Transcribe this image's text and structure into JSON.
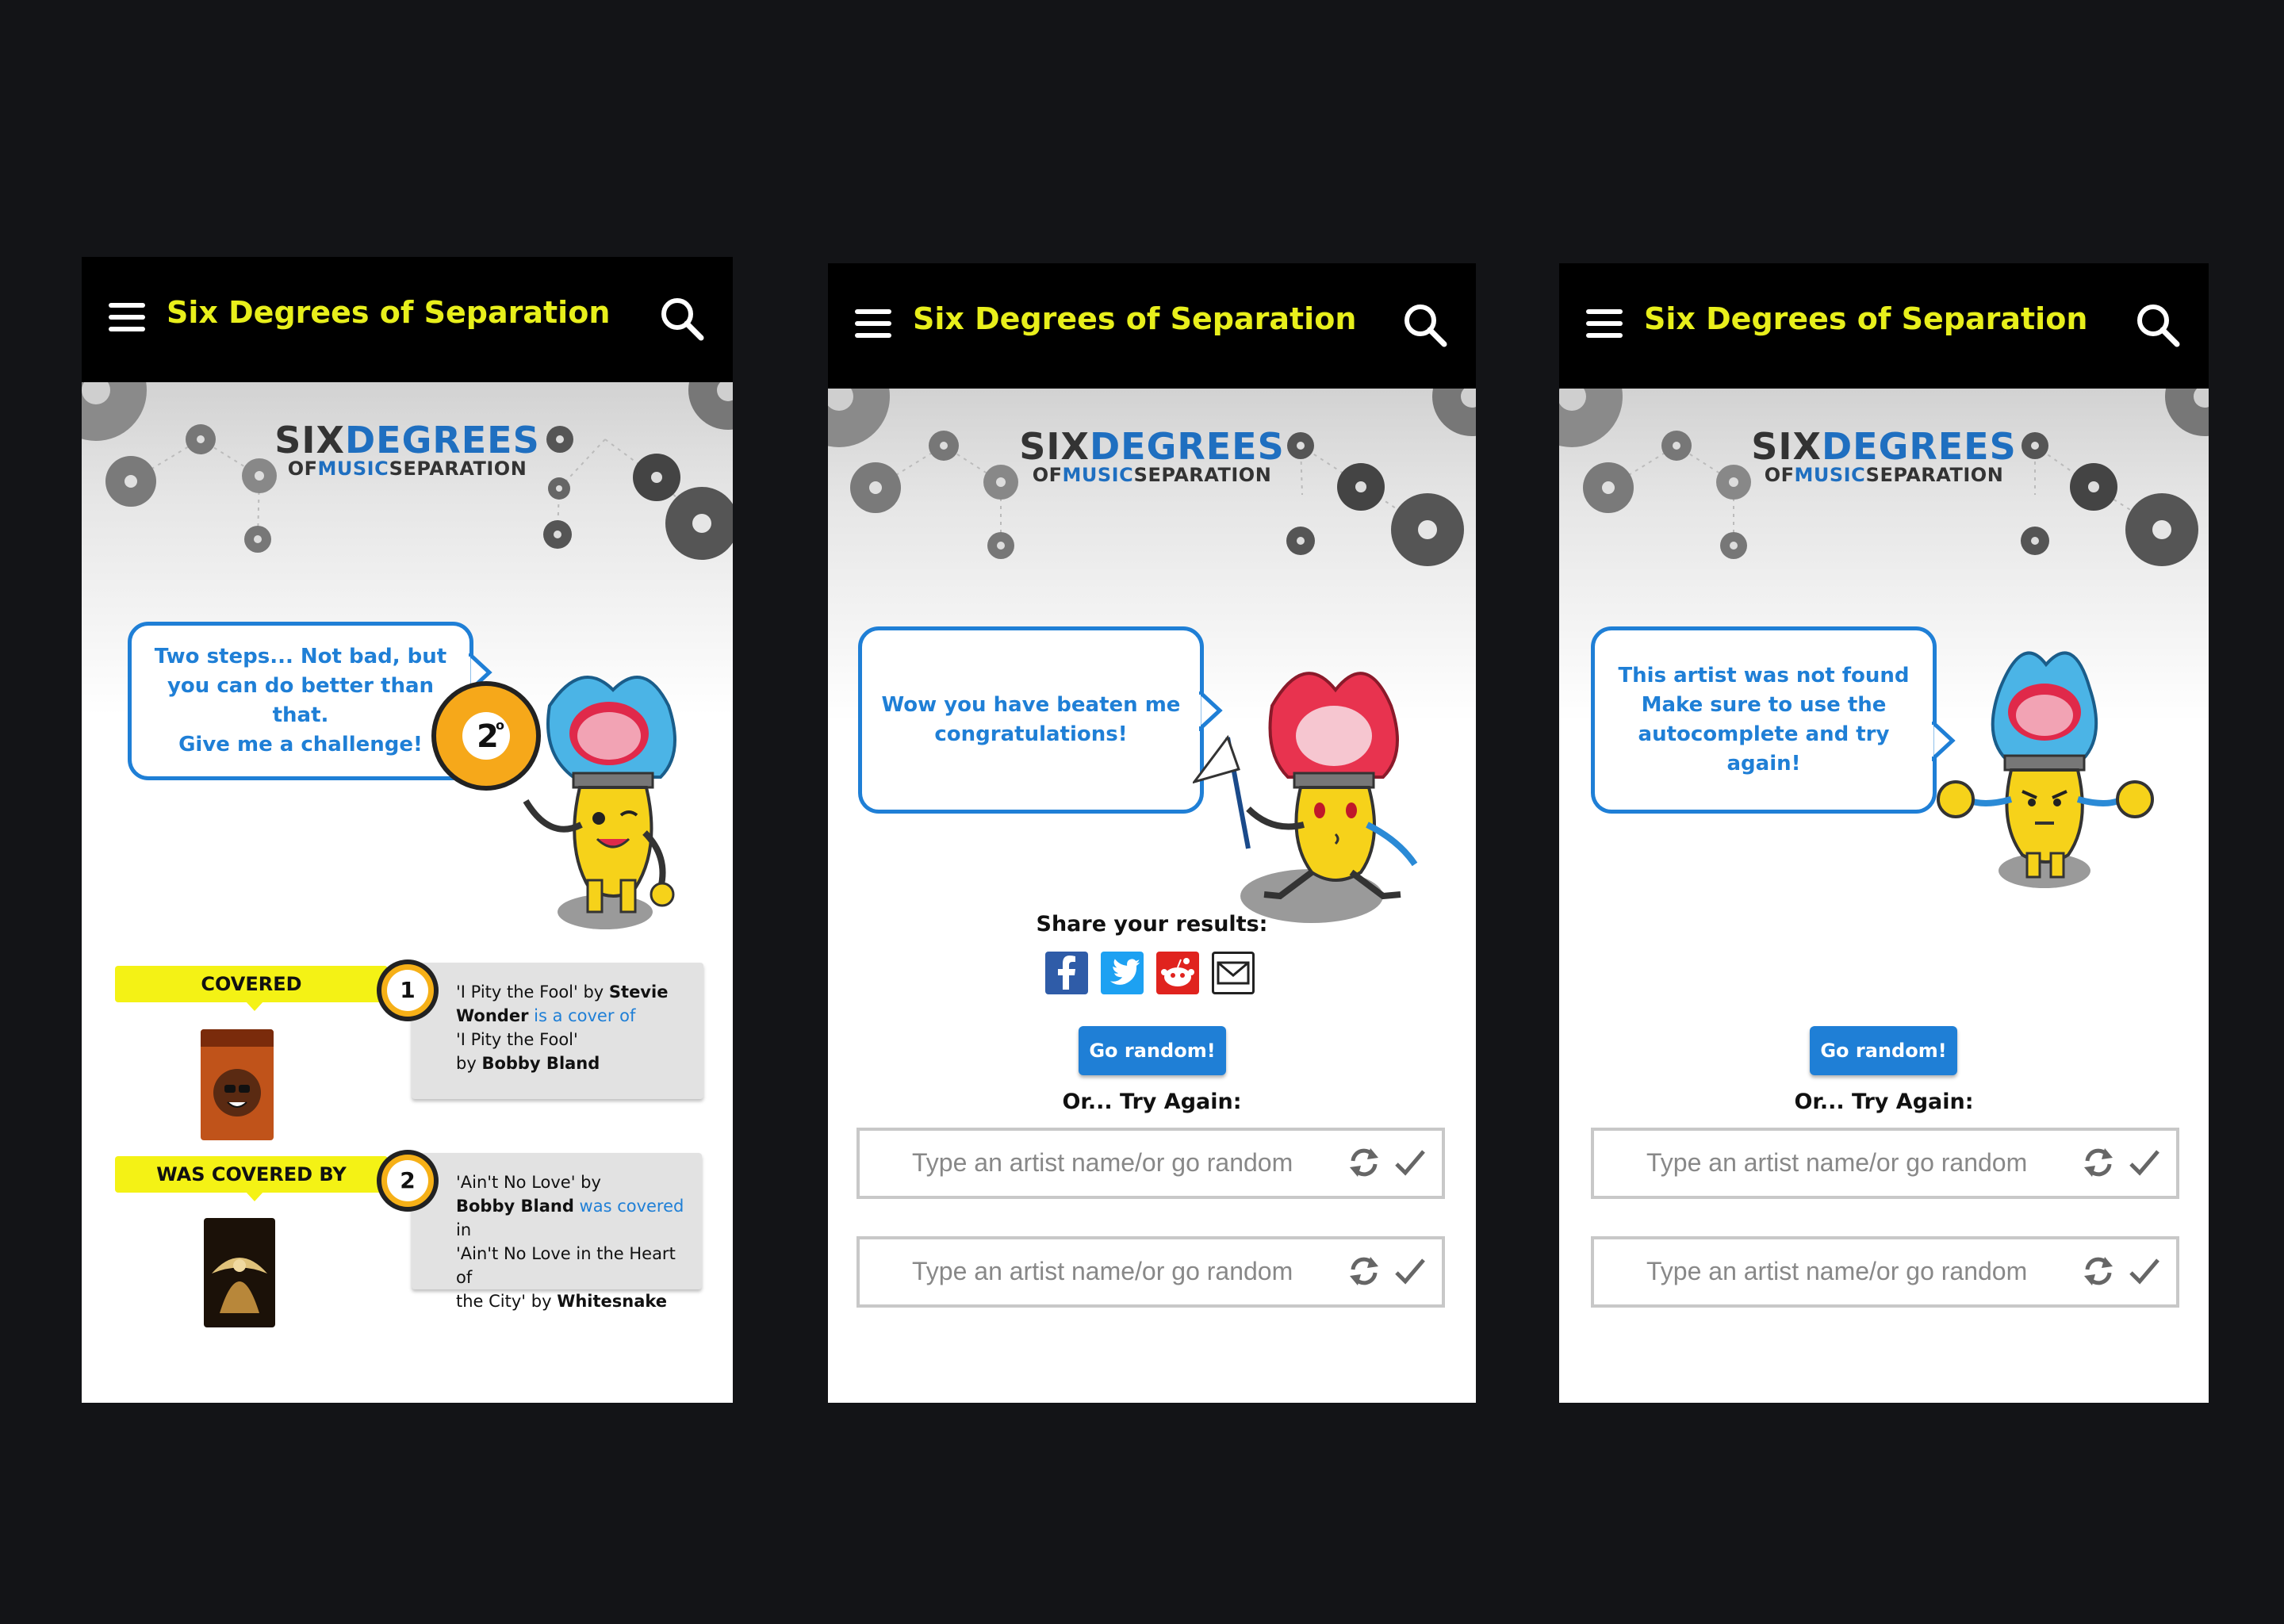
{
  "app_title": "Six Degrees of Separation",
  "logo": {
    "six": "SIX",
    "degrees": "DEGREES",
    "of": "OF",
    "music": "MUSIC",
    "separation": "SEPARATION"
  },
  "screen1": {
    "bubble": [
      "Two steps... Not bad, but",
      "you can do better than that.",
      "Give me a challenge!"
    ],
    "degree_badge": "2",
    "steps": [
      {
        "tag": "COVERED",
        "badge": "1",
        "line1_a": "'I Pity the Fool' by ",
        "line1_b": "Stevie",
        "line2_a": "Wonder",
        "line2_link": " is a cover of",
        "line3": "'I Pity the Fool'",
        "line4_a": "by ",
        "line4_b": "Bobby Bland"
      },
      {
        "tag": "WAS COVERED BY",
        "badge": "2",
        "line1": "'Ain't No Love' by",
        "line2_a": "Bobby Bland",
        "line2_link": " was covered",
        "line2_c": " in",
        "line3": "'Ain't No Love in the Heart of",
        "line4_a": "the City' by ",
        "line4_b": "Whitesnake"
      }
    ]
  },
  "screen2": {
    "bubble": [
      "Wow you have beaten me",
      "congratulations!"
    ],
    "share_label": "Share your results:",
    "share_icons": [
      "facebook-icon",
      "twitter-icon",
      "reddit-icon",
      "email-icon"
    ],
    "go_random": "Go random!",
    "try_again": "Or... Try Again:",
    "input1_placeholder": "Type an artist name/or go random",
    "input2_placeholder": "Type an artist name/or go random"
  },
  "screen3": {
    "bubble": [
      "This artist  was not found",
      "Make sure to use the",
      "autocomplete and try again!"
    ],
    "go_random": "Go random!",
    "try_again": "Or... Try Again:",
    "input1_placeholder": "Type an artist name/or go random",
    "input2_placeholder": "Type an artist name/or go random"
  },
  "colors": {
    "accent": "#1f7fd6",
    "title": "#e8ef1b",
    "tag": "#f4f215",
    "badge": "#f6b017"
  }
}
